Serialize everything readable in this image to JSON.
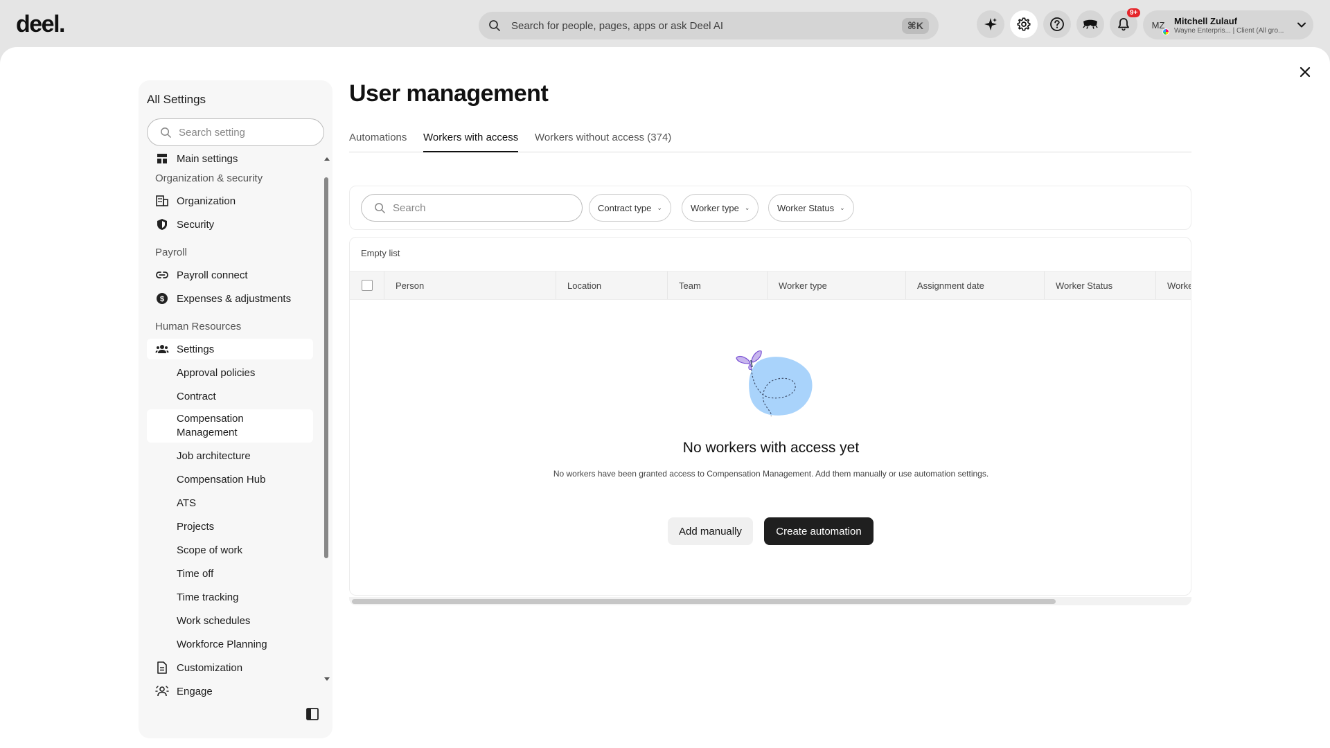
{
  "topbar": {
    "logo": "deel.",
    "search_placeholder": "Search for people, pages, apps or ask Deel AI",
    "shortcut": "⌘K",
    "notification_badge": "9+",
    "user": {
      "initials": "MZ",
      "name": "Mitchell Zulauf",
      "subtitle": "Wayne Enterpris... | Client (All gro..."
    }
  },
  "sidebar": {
    "title": "All Settings",
    "search_placeholder": "Search setting",
    "main_settings": "Main settings",
    "sections": {
      "org_security": "Organization & security",
      "payroll": "Payroll",
      "human_resources": "Human Resources"
    },
    "items": {
      "organization": "Organization",
      "security": "Security",
      "payroll_connect": "Payroll connect",
      "expenses": "Expenses & adjustments",
      "settings": "Settings",
      "approval_policies": "Approval policies",
      "contract": "Contract",
      "compensation_management_1": "Compensation",
      "compensation_management_2": "Management",
      "job_architecture": "Job architecture",
      "compensation_hub": "Compensation Hub",
      "ats": "ATS",
      "projects": "Projects",
      "scope_of_work": "Scope of work",
      "time_off": "Time off",
      "time_tracking": "Time tracking",
      "work_schedules": "Work schedules",
      "workforce_planning": "Workforce Planning",
      "customization": "Customization",
      "engage": "Engage"
    }
  },
  "main": {
    "title": "User management",
    "tabs": [
      "Automations",
      "Workers with access",
      "Workers without access (374)"
    ],
    "active_tab": "Workers with access",
    "filters": {
      "search_placeholder": "Search",
      "contract_type": "Contract type",
      "worker_type": "Worker type",
      "worker_status": "Worker Status"
    },
    "table": {
      "empty_label": "Empty list",
      "columns": [
        "Person",
        "Location",
        "Team",
        "Worker type",
        "Assignment date",
        "Worker Status",
        "Worke"
      ]
    },
    "empty_state": {
      "title": "No workers with access yet",
      "description": "No workers have been granted access to Compensation Management. Add them manually or use automation settings.",
      "add_manually": "Add manually",
      "create_automation": "Create automation"
    }
  }
}
